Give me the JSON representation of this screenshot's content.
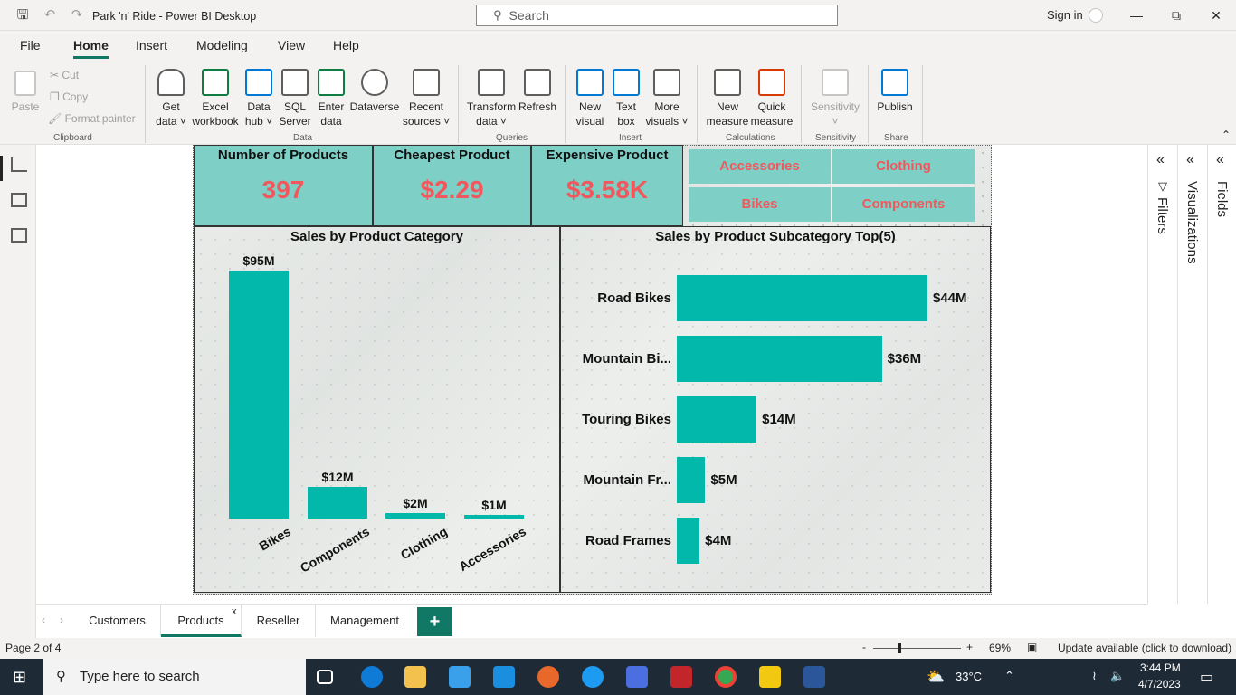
{
  "window": {
    "title": "Park 'n' Ride - Power BI Desktop",
    "search_placeholder": "Search",
    "sign_in": "Sign in"
  },
  "menu": [
    "File",
    "Home",
    "Insert",
    "Modeling",
    "View",
    "Help"
  ],
  "ribbon": {
    "clipboard": {
      "paste": "Paste",
      "cut": "Cut",
      "copy": "Copy",
      "format_painter": "Format painter",
      "group": "Clipboard"
    },
    "data": {
      "get_data": [
        "Get",
        "data"
      ],
      "excel": [
        "Excel",
        "workbook"
      ],
      "data_hub": [
        "Data",
        "hub"
      ],
      "sql": [
        "SQL",
        "Server"
      ],
      "enter": [
        "Enter",
        "data"
      ],
      "dataverse": [
        "Dataverse",
        ""
      ],
      "recent": [
        "Recent",
        "sources"
      ],
      "group": "Data"
    },
    "queries": {
      "transform": [
        "Transform",
        "data"
      ],
      "refresh": [
        "Refresh",
        ""
      ],
      "group": "Queries"
    },
    "insert": {
      "new_visual": [
        "New",
        "visual"
      ],
      "text_box": [
        "Text",
        "box"
      ],
      "more_visuals": [
        "More",
        "visuals"
      ],
      "group": "Insert"
    },
    "calculations": {
      "new_measure": [
        "New",
        "measure"
      ],
      "quick_measure": [
        "Quick",
        "measure"
      ],
      "group": "Calculations"
    },
    "sensitivity": {
      "label": "Sensitivity",
      "group": "Sensitivity"
    },
    "share": {
      "publish": "Publish",
      "group": "Share"
    }
  },
  "kpis": [
    {
      "title": "Number of Products",
      "value": "397"
    },
    {
      "title": "Cheapest Product",
      "value": "$2.29"
    },
    {
      "title": "Expensive Product",
      "value": "$3.58K"
    }
  ],
  "slicers": [
    "Accessories",
    "Clothing",
    "Bikes",
    "Components"
  ],
  "chart_data": [
    {
      "type": "bar",
      "title": "Sales by Product Category",
      "categories": [
        "Bikes",
        "Components",
        "Clothing",
        "Accessories"
      ],
      "values": [
        95,
        12,
        2,
        1
      ],
      "data_labels": [
        "$95M",
        "$12M",
        "$2M",
        "$1M"
      ],
      "unit": "$M",
      "color": "#01b8aa"
    },
    {
      "type": "bar",
      "orientation": "horizontal",
      "title": "Sales by Product Subcategory Top(5)",
      "categories": [
        "Road Bikes",
        "Mountain Bi...",
        "Touring Bikes",
        "Mountain Fr...",
        "Road Frames"
      ],
      "values": [
        44,
        36,
        14,
        5,
        4
      ],
      "data_labels": [
        "$44M",
        "$36M",
        "$14M",
        "$5M",
        "$4M"
      ],
      "unit": "$M",
      "color": "#01b8aa"
    }
  ],
  "panes": {
    "filters": "Filters",
    "visualizations": "Visualizations",
    "fields": "Fields"
  },
  "tabs": [
    "Customers",
    "Products",
    "Reseller",
    "Management"
  ],
  "status": {
    "page": "Page 2 of 4",
    "zoom": "69%",
    "update": "Update available (click to download)"
  },
  "taskbar": {
    "search": "Type here to search",
    "weather": "33°C",
    "time": "3:44 PM",
    "date": "4/7/2023"
  }
}
